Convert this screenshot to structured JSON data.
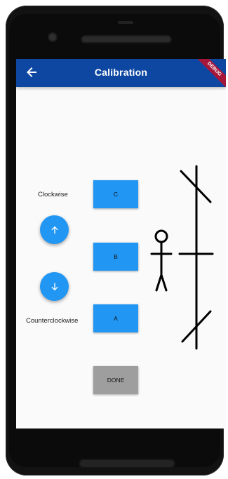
{
  "appbar": {
    "title": "Calibration"
  },
  "debug_banner": "DEBUG",
  "labels": {
    "clockwise": "Clockwise",
    "counterclockwise": "Counterclockwise"
  },
  "buttons": {
    "c": "C",
    "b": "B",
    "a": "A",
    "done": "DONE"
  },
  "icons": {
    "back": "arrow-back-icon",
    "up": "arrow-up-icon",
    "down": "arrow-down-icon"
  },
  "colors": {
    "appbar": "#0d47a1",
    "primary_button": "#2196f3",
    "done_button": "#9e9e9e",
    "debug_banner": "#a6163a"
  }
}
